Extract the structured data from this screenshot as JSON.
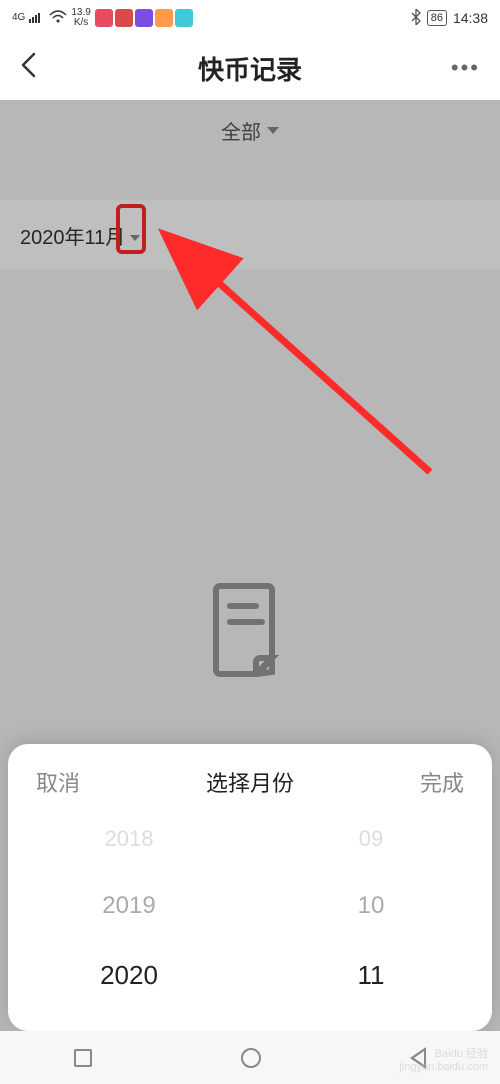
{
  "status": {
    "network": "4G",
    "speed_value": "13.9",
    "speed_unit": "K/s",
    "battery": "86",
    "time": "14:38",
    "icon_colors": [
      "#e84a5f",
      "#d94a48",
      "#7b4de0",
      "#ff9a4a",
      "#3fc9d9"
    ]
  },
  "header": {
    "title": "快币记录"
  },
  "filter": {
    "all_label": "全部"
  },
  "date": {
    "label": "2020年11月"
  },
  "picker": {
    "cancel": "取消",
    "title": "选择月份",
    "done": "完成",
    "years": [
      "2018",
      "2019",
      "2020"
    ],
    "months": [
      "09",
      "10",
      "11"
    ]
  },
  "watermark": {
    "line1": "Baidu 经验",
    "line2": "jingyan.baidu.com"
  }
}
